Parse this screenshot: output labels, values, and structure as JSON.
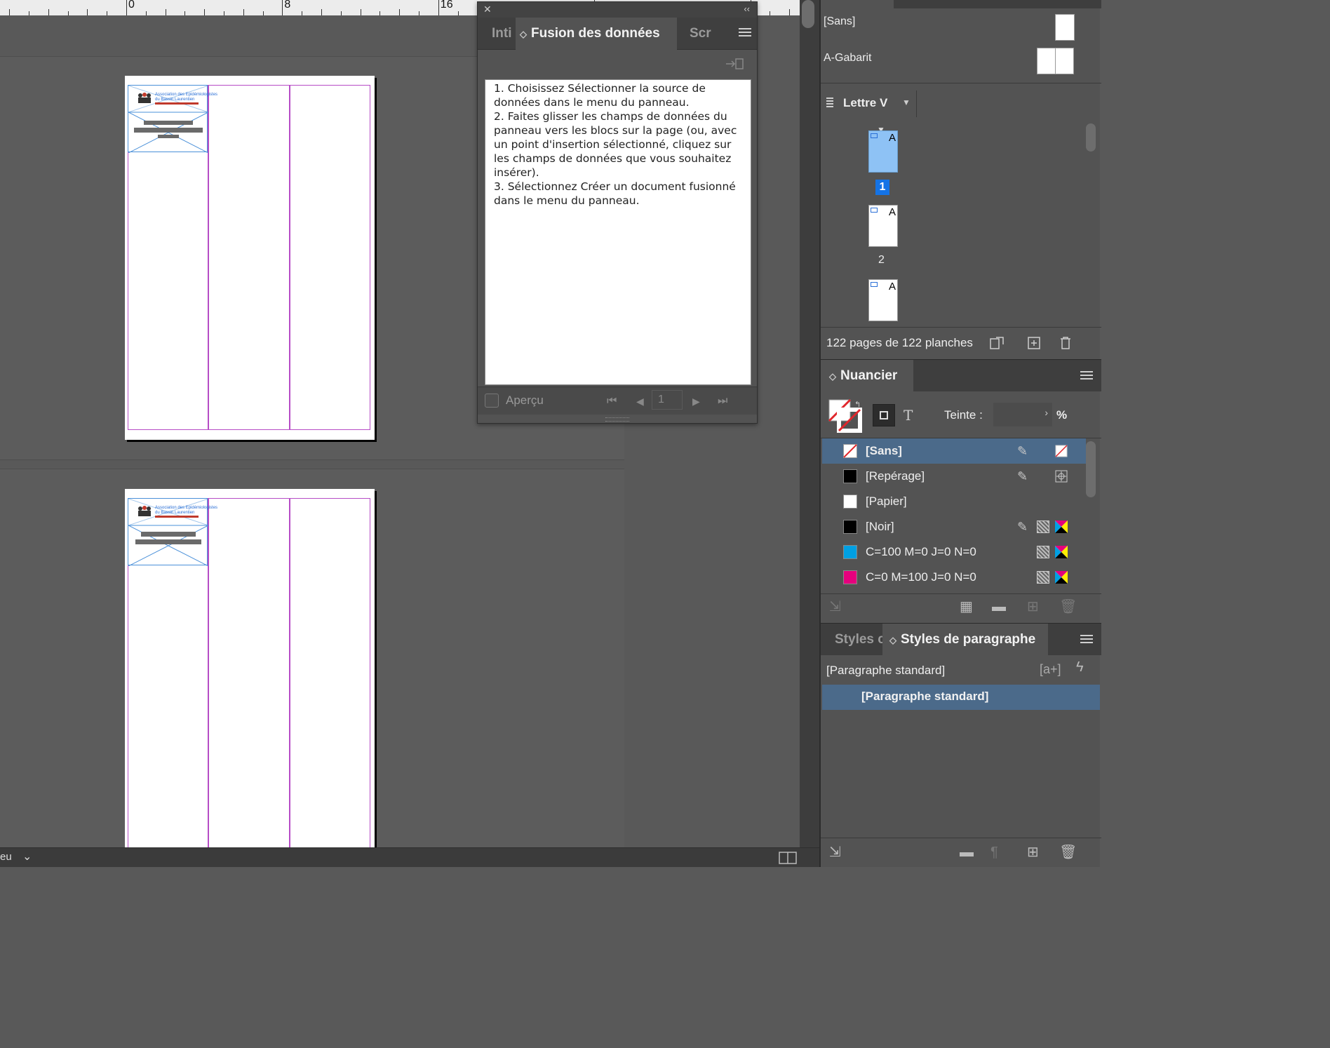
{
  "ruler": {
    "labels": [
      "0",
      "8",
      "16"
    ]
  },
  "canvas": {
    "logo_line1": "Association des Epidémiologistes",
    "logo_line2": "du Bassin Laurentien"
  },
  "statusbar": {
    "left_label": "eu",
    "chevron": "⌄"
  },
  "merge_panel": {
    "close": "✕",
    "collapse": "‹‹",
    "tabs": [
      "Inti",
      "Fusion des données",
      "Scr"
    ],
    "active_tab": "Fusion des données",
    "instructions": "1. Choisissez Sélectionner la source de données dans le menu du panneau.\n2. Faites glisser les champs de données du panneau vers les blocs sur la page (ou, avec un point d'insertion sélectionné, cliquez sur les champs de données que vous souhaitez insérer).\n3. Sélectionnez Créer un document fusionné dans le menu du panneau.",
    "preview_label": "Aperçu",
    "record_number": "1"
  },
  "pages_panel": {
    "masters": [
      "[Sans]",
      "A-Gabarit"
    ],
    "master_dropdown": "Lettre V",
    "page_thumbs": [
      {
        "label": "1",
        "master": "A",
        "selected": true
      },
      {
        "label": "2",
        "master": "A",
        "selected": false
      },
      {
        "label": "",
        "master": "A",
        "selected": false
      }
    ],
    "status": "122 pages de 122 planches"
  },
  "swatches_panel": {
    "title": "Nuancier",
    "tint_label": "Teinte :",
    "percent": "%",
    "swatches": [
      {
        "name": "[Sans]",
        "color": "none",
        "selected": true
      },
      {
        "name": "[Repérage]",
        "color": "#000000",
        "selected": false
      },
      {
        "name": "[Papier]",
        "color": "#ffffff",
        "selected": false
      },
      {
        "name": "[Noir]",
        "color": "#000000",
        "selected": false
      },
      {
        "name": "C=100 M=0 J=0 N=0",
        "color": "#00a0e3",
        "selected": false
      },
      {
        "name": "C=0 M=100 J=0 N=0",
        "color": "#e5007d",
        "selected": false
      }
    ]
  },
  "para_styles_panel": {
    "inactive_tab": "Styles c",
    "title": "Styles de paragraphe",
    "current_style": "[Paragraphe standard]",
    "styles": [
      "[Paragraphe standard]"
    ],
    "new_style_icon": "[a+]"
  }
}
